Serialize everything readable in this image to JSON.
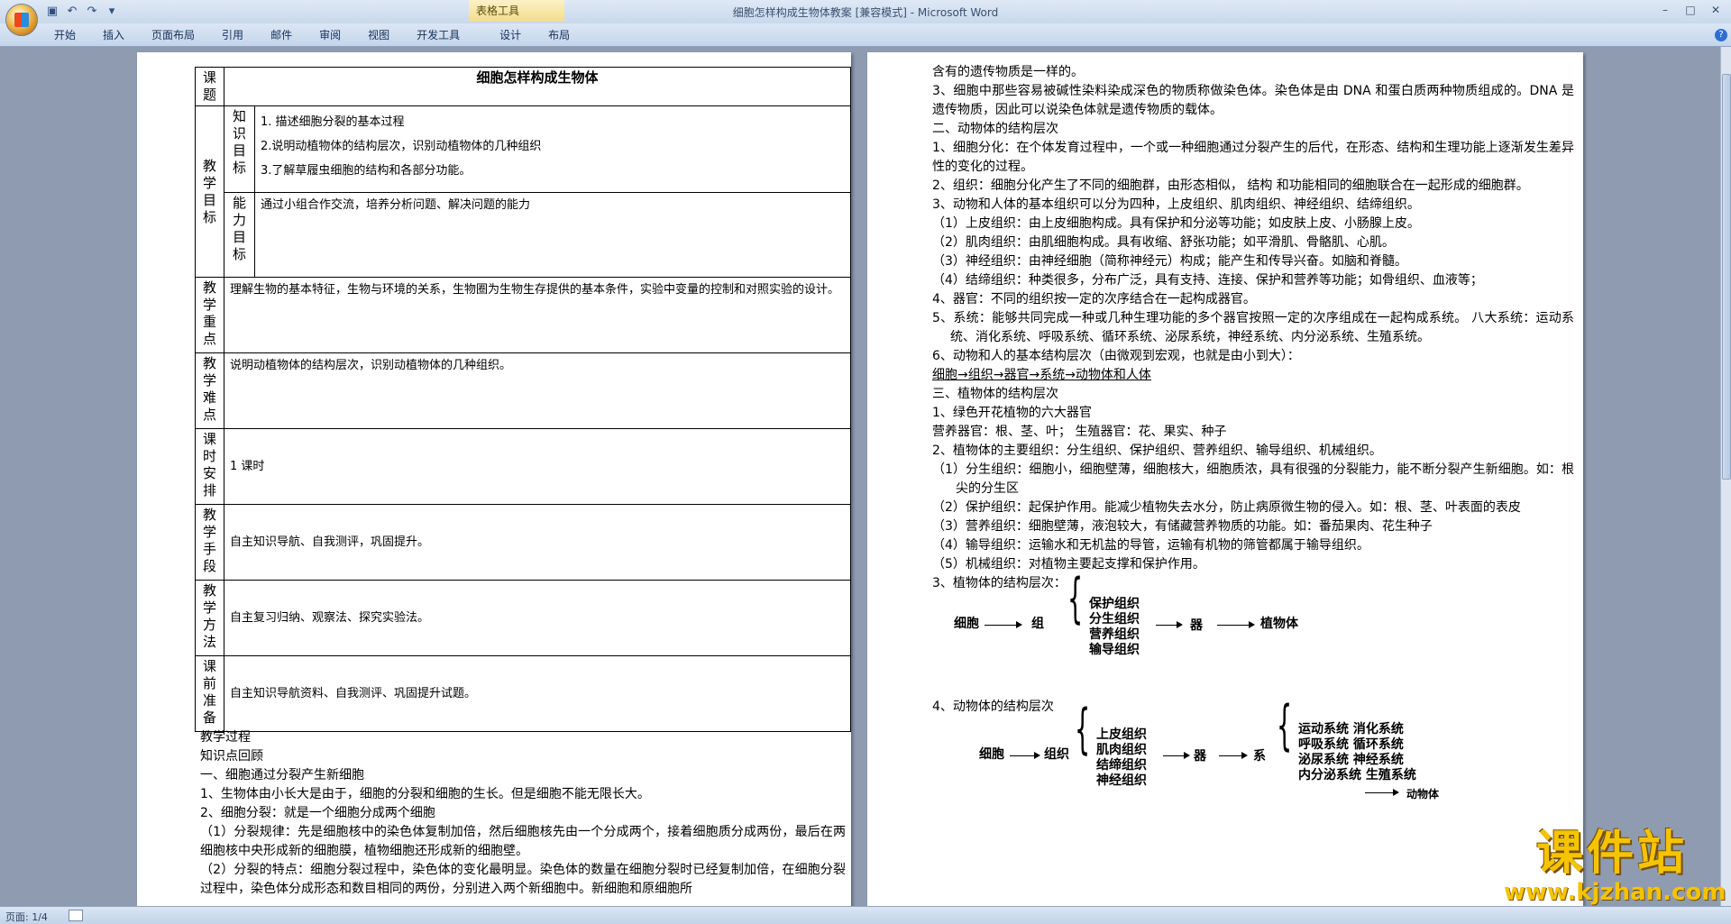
{
  "window": {
    "title": "细胞怎样构成生物体教案 [兼容模式] - Microsoft Word",
    "context_tab_group": "表格工具"
  },
  "ribbon": {
    "tabs": [
      "开始",
      "插入",
      "页面布局",
      "引用",
      "邮件",
      "审阅",
      "视图",
      "开发工具"
    ],
    "context_tabs": [
      "设计",
      "布局"
    ]
  },
  "status": {
    "page": "页面: 1/4"
  },
  "watermark": {
    "cn": "课件站",
    "url": "www.kjzhan.com"
  },
  "page1": {
    "table": {
      "title_label": "课题",
      "title": "细胞怎样构成生物体",
      "goals_label": "教学目标",
      "knowledge_label": "知识目标",
      "knowledge_items": [
        "1.  描述细胞分裂的基本过程",
        "2.说明动植物体的结构层次，识别动植物体的几种组织",
        "3.了解草履虫细胞的结构和各部分功能。"
      ],
      "ability_label": "能力目标",
      "ability_text": "通过小组合作交流，培养分析问题、解决问题的能力",
      "key_label": "教学重点",
      "key_text": "理解生物的基本特征，生物与环境的关系，生物圈为生物生存提供的基本条件，实验中变量的控制和对照实验的设计。",
      "difficult_label": "教学难点",
      "difficult_text": "说明动植物体的结构层次，识别动植物体的几种组织。",
      "schedule_label": "课时安排",
      "schedule_text": "1 课时",
      "means_label": "教学手段",
      "means_text": "自主知识导航、自我测评，巩固提升。",
      "method_label": "教学方法",
      "method_text": "自主复习归纳、观察法、探究实验法。",
      "prep_label": "课前准备",
      "prep_text": "自主知识导航资料、自我测评、巩固提升试题。"
    },
    "process": [
      "教学过程",
      "知识点回顾",
      "一、细胞通过分裂产生新细胞",
      "1、生物体由小长大是由于，细胞的分裂和细胞的生长。但是细胞不能无限长大。",
      "2、细胞分裂：就是一个细胞分成两个细胞",
      "（1）分裂规律：先是细胞核中的染色体复制加倍，然后细胞核先由一个分成两个，接着细胞质分成两份，最后在两细胞核中央形成新的细胞膜，植物细胞还形成新的细胞壁。",
      "（2）分裂的特点：细胞分裂过程中，染色体的变化最明显。染色体的数量在细胞分裂时已经复制加倍，在细胞分裂过程中，染色体分成形态和数目相同的两份，分别进入两个新细胞中。新细胞和原细胞所"
    ]
  },
  "page2": {
    "lines": [
      "含有的遗传物质是一样的。",
      "3、细胞中那些容易被碱性染料染成深色的物质称做染色体。染色体是由 DNA 和蛋白质两种物质组成的。DNA 是遗传物质，因此可以说染色体就是遗传物质的载体。",
      "二、动物体的结构层次",
      "1、细胞分化：在个体发育过程中，一个或一种细胞通过分裂产生的后代，在形态、结构和生理功能上逐渐发生差异性的变化的过程。",
      "2、组织：细胞分化产生了不同的细胞群，由形态相似， 结构 和功能相同的细胞联合在一起形成的细胞群。",
      "3、动物和人体的基本组织可以分为四种，上皮组织、肌肉组织、神经组织、结缔组织。",
      "（1）上皮组织：由上皮细胞构成。具有保护和分泌等功能；如皮肤上皮、小肠腺上皮。",
      "（2）肌肉组织：由肌细胞构成。具有收缩、舒张功能；如平滑肌、骨骼肌、心肌。",
      "（3）神经组织：由神经细胞（简称神经元）构成；能产生和传导兴奋。如脑和脊髓。",
      "（4）结缔组织：种类很多，分布广泛，具有支持、连接、保护和营养等功能；如骨组织、血液等；",
      "4、器官：不同的组织按一定的次序结合在一起构成器官。",
      "5、系统：能够共同完成一种或几种生理功能的多个器官按照一定的次序组成在一起构成系统。    八大系统：运动系统、消化系统、呼吸系统、循环系统、泌尿系统，神经系统、内分泌系统、生殖系统。",
      " 6、动物和人的基本结构层次（由微观到宏观，也就是由小到大）：",
      "细胞→组织→器官→系统→动物体和人体",
      "三、植物体的结构层次",
      "1、绿色开花植物的六大器官",
      "营养器官：根、茎、叶；          生殖器官：花、果实、种子",
      "2、植物体的主要组织：分生组织、保护组织、营养组织、输导组织、机械组织。",
      "（1）分生组织：细胞小，细胞壁薄，细胞核大，细胞质浓，具有很强的分裂能力，能不断分裂产生新细胞。如：根尖的分生区",
      "（2）保护组织：起保护作用。能减少植物失去水分，防止病原微生物的侵入。如：根、茎、叶表面的表皮",
      "（3）营养组织：细胞壁薄，液泡较大，有储藏营养物质的功能。如：番茄果肉、花生种子",
      "（4）输导组织：运输水和无机盐的导管，运输有机物的筛管都属于输导组织。",
      "（5）机械组织：对植物主要起支撑和保护作用。",
      "3、植物体的结构层次："
    ],
    "plant_diagram": {
      "cell": "细胞",
      "tissue": "组",
      "tissues": [
        "保护组织",
        "分生组织",
        "营养组织",
        "输导组织"
      ],
      "organ": "器",
      "body": "植物体"
    },
    "animal_heading": "4、动物体的结构层次",
    "animal_diagram": {
      "cell": "细胞",
      "tissue": "组织",
      "tissues": [
        "上皮组织",
        "肌肉组织",
        "结缔组织",
        "神经组织"
      ],
      "organ": "器",
      "system": "系",
      "systems": [
        "运动系统  消化系统",
        "呼吸系统  循环系统",
        "泌尿系统  神经系统",
        "内分泌系统  生殖系统"
      ],
      "body": "动物体"
    }
  }
}
